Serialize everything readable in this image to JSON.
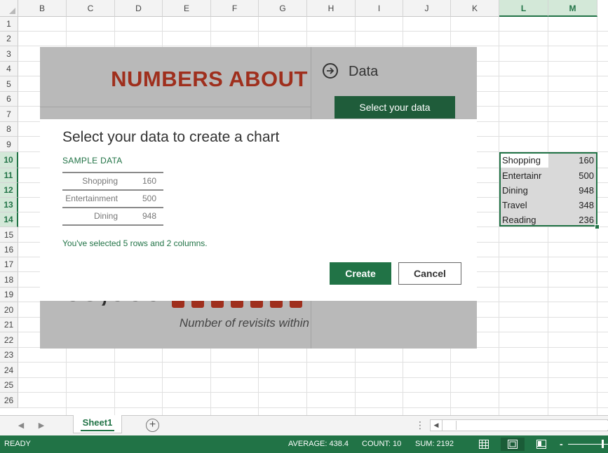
{
  "columns": [
    "B",
    "C",
    "D",
    "E",
    "F",
    "G",
    "H",
    "I",
    "J",
    "K",
    "L",
    "M"
  ],
  "rows": [
    "1",
    "2",
    "3",
    "4",
    "5",
    "6",
    "7",
    "8",
    "9",
    "10",
    "11",
    "12",
    "13",
    "14",
    "15",
    "16",
    "17",
    "18",
    "19",
    "20",
    "21",
    "22",
    "23",
    "24",
    "25",
    "26"
  ],
  "selected_columns": [
    "L",
    "M"
  ],
  "selected_rows": [
    "10",
    "11",
    "12",
    "13",
    "14"
  ],
  "cells": [
    {
      "label": "Shopping",
      "value": "160"
    },
    {
      "label": "Entertainr",
      "value": "500"
    },
    {
      "label": "Dining",
      "value": "948"
    },
    {
      "label": "Travel",
      "value": "348"
    },
    {
      "label": "Reading",
      "value": "236"
    }
  ],
  "card": {
    "title": "NUMBERS ABOUT",
    "data_heading": "Data",
    "select_button": "Select your data",
    "big_number": "65,000",
    "revisits_text": "Number of revisits within"
  },
  "modal": {
    "title": "Select your data to create a chart",
    "sample_label": "SAMPLE DATA",
    "sample_rows": [
      {
        "label": "Shopping",
        "value": "160"
      },
      {
        "label": "Entertainment",
        "value": "500"
      },
      {
        "label": "Dining",
        "value": "948"
      }
    ],
    "status": "You've selected 5 rows and 2 columns.",
    "create_button": "Create",
    "cancel_button": "Cancel"
  },
  "tabs": {
    "sheet_name": "Sheet1",
    "add_sheet": "+",
    "prev": "◀",
    "next": "▶",
    "scroll_left": "◀",
    "more": "⋮"
  },
  "status": {
    "ready": "READY",
    "average": "AVERAGE: 438.4",
    "count": "COUNT: 10",
    "sum": "SUM: 2192",
    "zoom_minus": "-"
  },
  "colors": {
    "excel_green": "#217346",
    "title_red": "#9f2f1d",
    "card_gray": "#b9b9b9"
  },
  "icons": [
    "arrow-circle-icon",
    "people-icons",
    "normal-view-icon",
    "page-layout-icon",
    "page-break-icon",
    "add-sheet-icon"
  ]
}
